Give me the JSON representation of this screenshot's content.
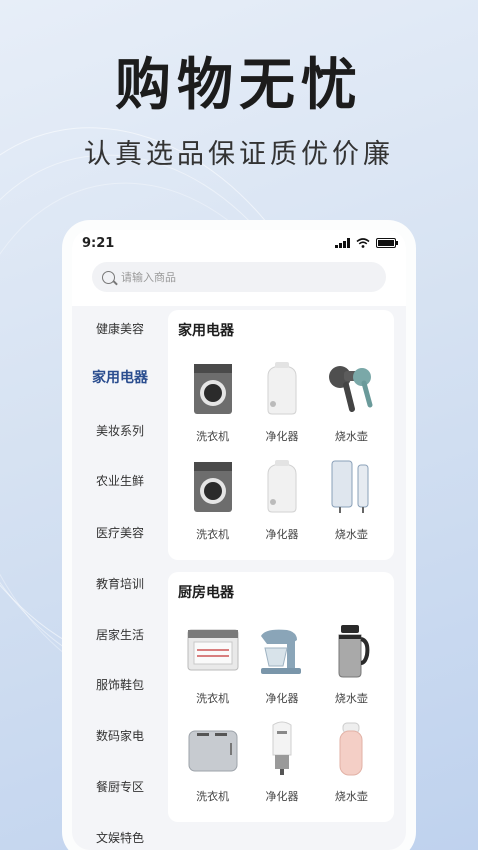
{
  "promo": {
    "headline": "购物无忧",
    "subline": "认真选品保证质优价廉"
  },
  "status_bar": {
    "time": "9:21",
    "icons": [
      "signal-icon",
      "wifi-icon",
      "battery-icon"
    ]
  },
  "search": {
    "placeholder": "请输入商品"
  },
  "sidebar": {
    "items": [
      {
        "label": "健康美容",
        "active": false
      },
      {
        "label": "家用电器",
        "active": true
      },
      {
        "label": "美妆系列",
        "active": false
      },
      {
        "label": "农业生鲜",
        "active": false
      },
      {
        "label": "医疗美容",
        "active": false
      },
      {
        "label": "教育培训",
        "active": false
      },
      {
        "label": "居家生活",
        "active": false
      },
      {
        "label": "服饰鞋包",
        "active": false
      },
      {
        "label": "数码家电",
        "active": false
      },
      {
        "label": "餐厨专区",
        "active": false
      },
      {
        "label": "文娱特色",
        "active": false
      }
    ]
  },
  "sections": [
    {
      "title": "家用电器",
      "products": [
        {
          "label": "洗衣机",
          "icon": "washing-machine-icon"
        },
        {
          "label": "净化器",
          "icon": "humidifier-icon"
        },
        {
          "label": "烧水壶",
          "icon": "hair-dryer-icon"
        },
        {
          "label": "洗衣机",
          "icon": "washing-machine-icon"
        },
        {
          "label": "净化器",
          "icon": "humidifier-icon"
        },
        {
          "label": "烧水壶",
          "icon": "water-heater-icon"
        }
      ]
    },
    {
      "title": "厨房电器",
      "products": [
        {
          "label": "洗衣机",
          "icon": "oven-icon"
        },
        {
          "label": "净化器",
          "icon": "stand-mixer-icon"
        },
        {
          "label": "烧水壶",
          "icon": "thermos-kettle-icon"
        },
        {
          "label": "洗衣机",
          "icon": "toaster-icon"
        },
        {
          "label": "净化器",
          "icon": "car-charger-icon"
        },
        {
          "label": "烧水壶",
          "icon": "mini-humidifier-icon"
        }
      ]
    }
  ],
  "colors": {
    "accent": "#2a4d8f",
    "background_top": "#e7eef8",
    "background_bottom": "#bfd2ee"
  }
}
